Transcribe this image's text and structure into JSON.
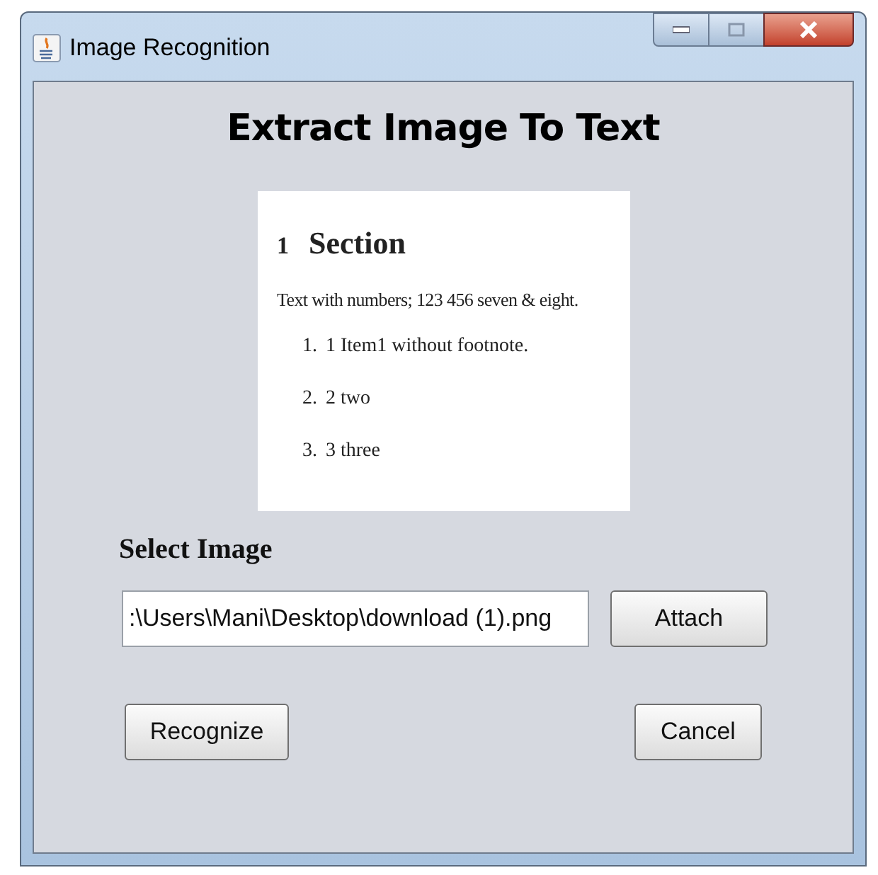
{
  "window": {
    "title": "Image Recognition"
  },
  "heading": "Extract Image To Text",
  "preview": {
    "section_number": "1",
    "section_title": "Section",
    "paragraph": "Text with numbers; 123 456 seven & eight.",
    "items": [
      {
        "marker": "1.",
        "text": "1 Item1 without footnote."
      },
      {
        "marker": "2.",
        "text": "2 two"
      },
      {
        "marker": "3.",
        "text": "3 three"
      }
    ]
  },
  "select_label": "Select Image",
  "file_field": {
    "value": ":\\Users\\Mani\\Desktop\\download (1).png"
  },
  "buttons": {
    "attach": "Attach",
    "recognize": "Recognize",
    "cancel": "Cancel"
  }
}
